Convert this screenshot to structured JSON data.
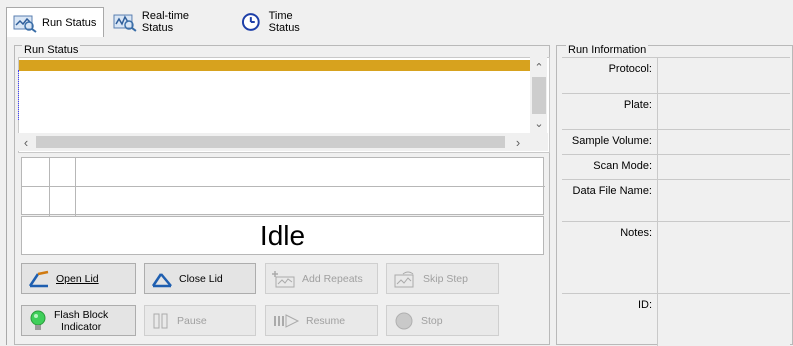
{
  "tabs": [
    {
      "label": "Run Status",
      "icon": "run-status-icon",
      "active": true
    },
    {
      "label": "Real-time Status",
      "icon": "realtime-status-icon",
      "active": false
    },
    {
      "label": "Time Status",
      "icon": "clock-icon",
      "active": false
    }
  ],
  "run_status": {
    "title": "Run Status",
    "state": "Idle",
    "selection_color": "#d7a21e"
  },
  "buttons": {
    "open_lid": {
      "label": "Open Lid",
      "mnemonic": "O",
      "enabled": true
    },
    "close_lid": {
      "label": "Close Lid",
      "mnemonic": "C",
      "enabled": true
    },
    "add_repeats": {
      "label": "Add Repeats",
      "enabled": false
    },
    "skip_step": {
      "label": "Skip Step",
      "enabled": false
    },
    "flash_block": {
      "label1": "Flash Block",
      "label2": "Indicator",
      "enabled": true
    },
    "pause": {
      "label": "Pause",
      "enabled": false
    },
    "resume": {
      "label": "Resume",
      "enabled": false
    },
    "stop": {
      "label": "Stop",
      "enabled": false
    }
  },
  "run_info": {
    "title": "Run Information",
    "fields": [
      {
        "label": "Protocol:",
        "value": ""
      },
      {
        "label": "Plate:",
        "value": ""
      },
      {
        "label": "Sample Volume:",
        "value": ""
      },
      {
        "label": "Scan Mode:",
        "value": ""
      },
      {
        "label": "Data File Name:",
        "value": ""
      },
      {
        "label": "Notes:",
        "value": ""
      },
      {
        "label": "ID:",
        "value": ""
      }
    ]
  }
}
